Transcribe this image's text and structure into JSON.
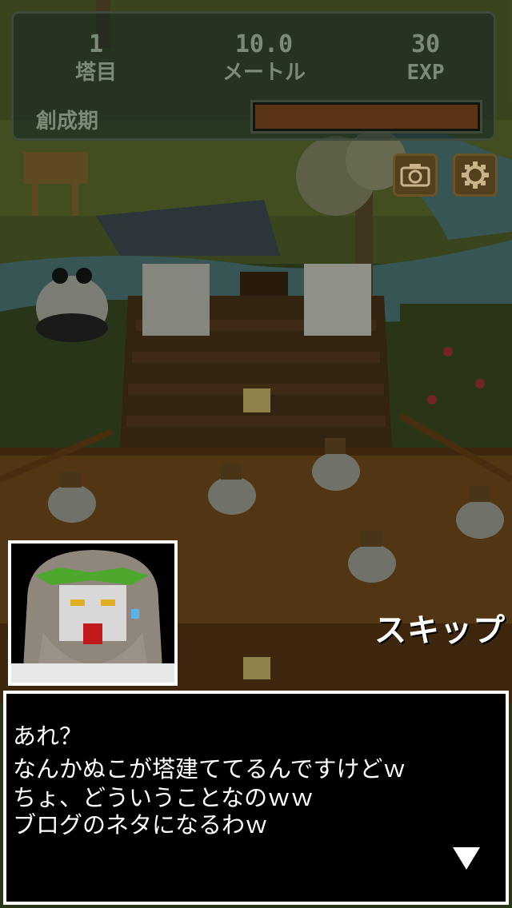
{
  "hud": {
    "floor": {
      "value": "1",
      "label": "塔目"
    },
    "height": {
      "value": "10.0",
      "label": "メートル"
    },
    "exp": {
      "value": "30",
      "label": "EXP"
    },
    "era_label": "創成期",
    "era_progress": 0.0
  },
  "buttons": {
    "camera_icon": "camera-icon",
    "settings_icon": "gear-icon",
    "skip_label": "スキップ",
    "next_icon": "down-triangle-icon"
  },
  "dialog": {
    "speaker_portrait": "bearded-god-portrait",
    "lines": [
      "あれ？",
      "なんかぬこが塔建ててるんですけどｗ",
      "ちょ、どういうことなのｗｗ",
      "ブログのネタになるわｗ"
    ]
  },
  "colors": {
    "dialog_bg": "#000000",
    "dialog_border": "#ffffff",
    "hud_text": "#7c8a78",
    "button_bg": "#53401d"
  }
}
